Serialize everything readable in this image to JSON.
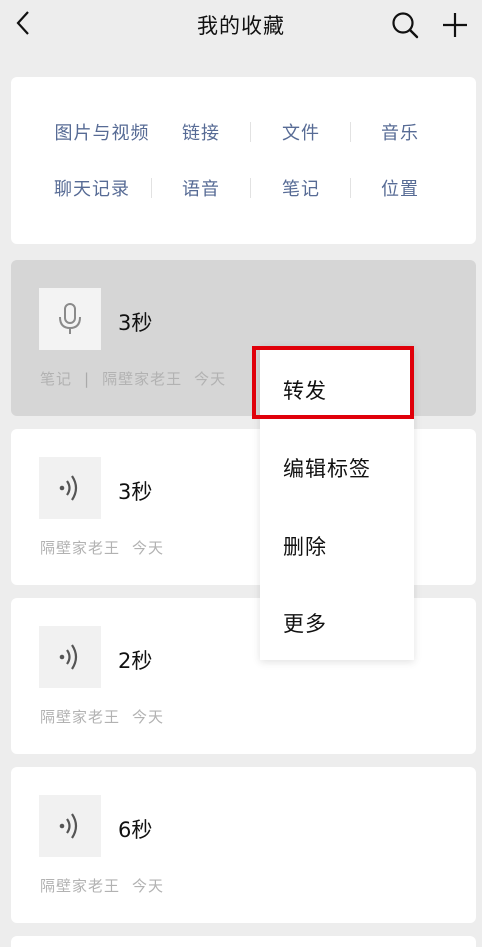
{
  "header": {
    "title": "我的收藏",
    "back_icon": "chevron-left-icon",
    "search_icon": "search-icon",
    "add_icon": "plus-icon"
  },
  "filters": {
    "row1": [
      "图片与视频",
      "链接",
      "文件",
      "音乐"
    ],
    "row2": [
      "聊天记录",
      "语音",
      "笔记",
      "位置"
    ]
  },
  "items": [
    {
      "duration": "3秒",
      "tag": "笔记",
      "source": "隔壁家老王",
      "time": "今天",
      "icon": "microphone-icon"
    },
    {
      "duration": "3秒",
      "source": "隔壁家老王",
      "time": "今天",
      "icon": "voice-wave-icon"
    },
    {
      "duration": "2秒",
      "source": "隔壁家老王",
      "time": "今天",
      "icon": "voice-wave-icon"
    },
    {
      "duration": "6秒",
      "source": "隔壁家老王",
      "time": "今天",
      "icon": "voice-wave-icon"
    }
  ],
  "context_menu": {
    "items": [
      "转发",
      "编辑标签",
      "删除",
      "更多"
    ],
    "highlight_color": "#e0000a"
  },
  "colors": {
    "background": "#ededed",
    "link": "#576b95",
    "selected_card": "#d6d6d6",
    "meta_text": "#b2b2b2"
  }
}
